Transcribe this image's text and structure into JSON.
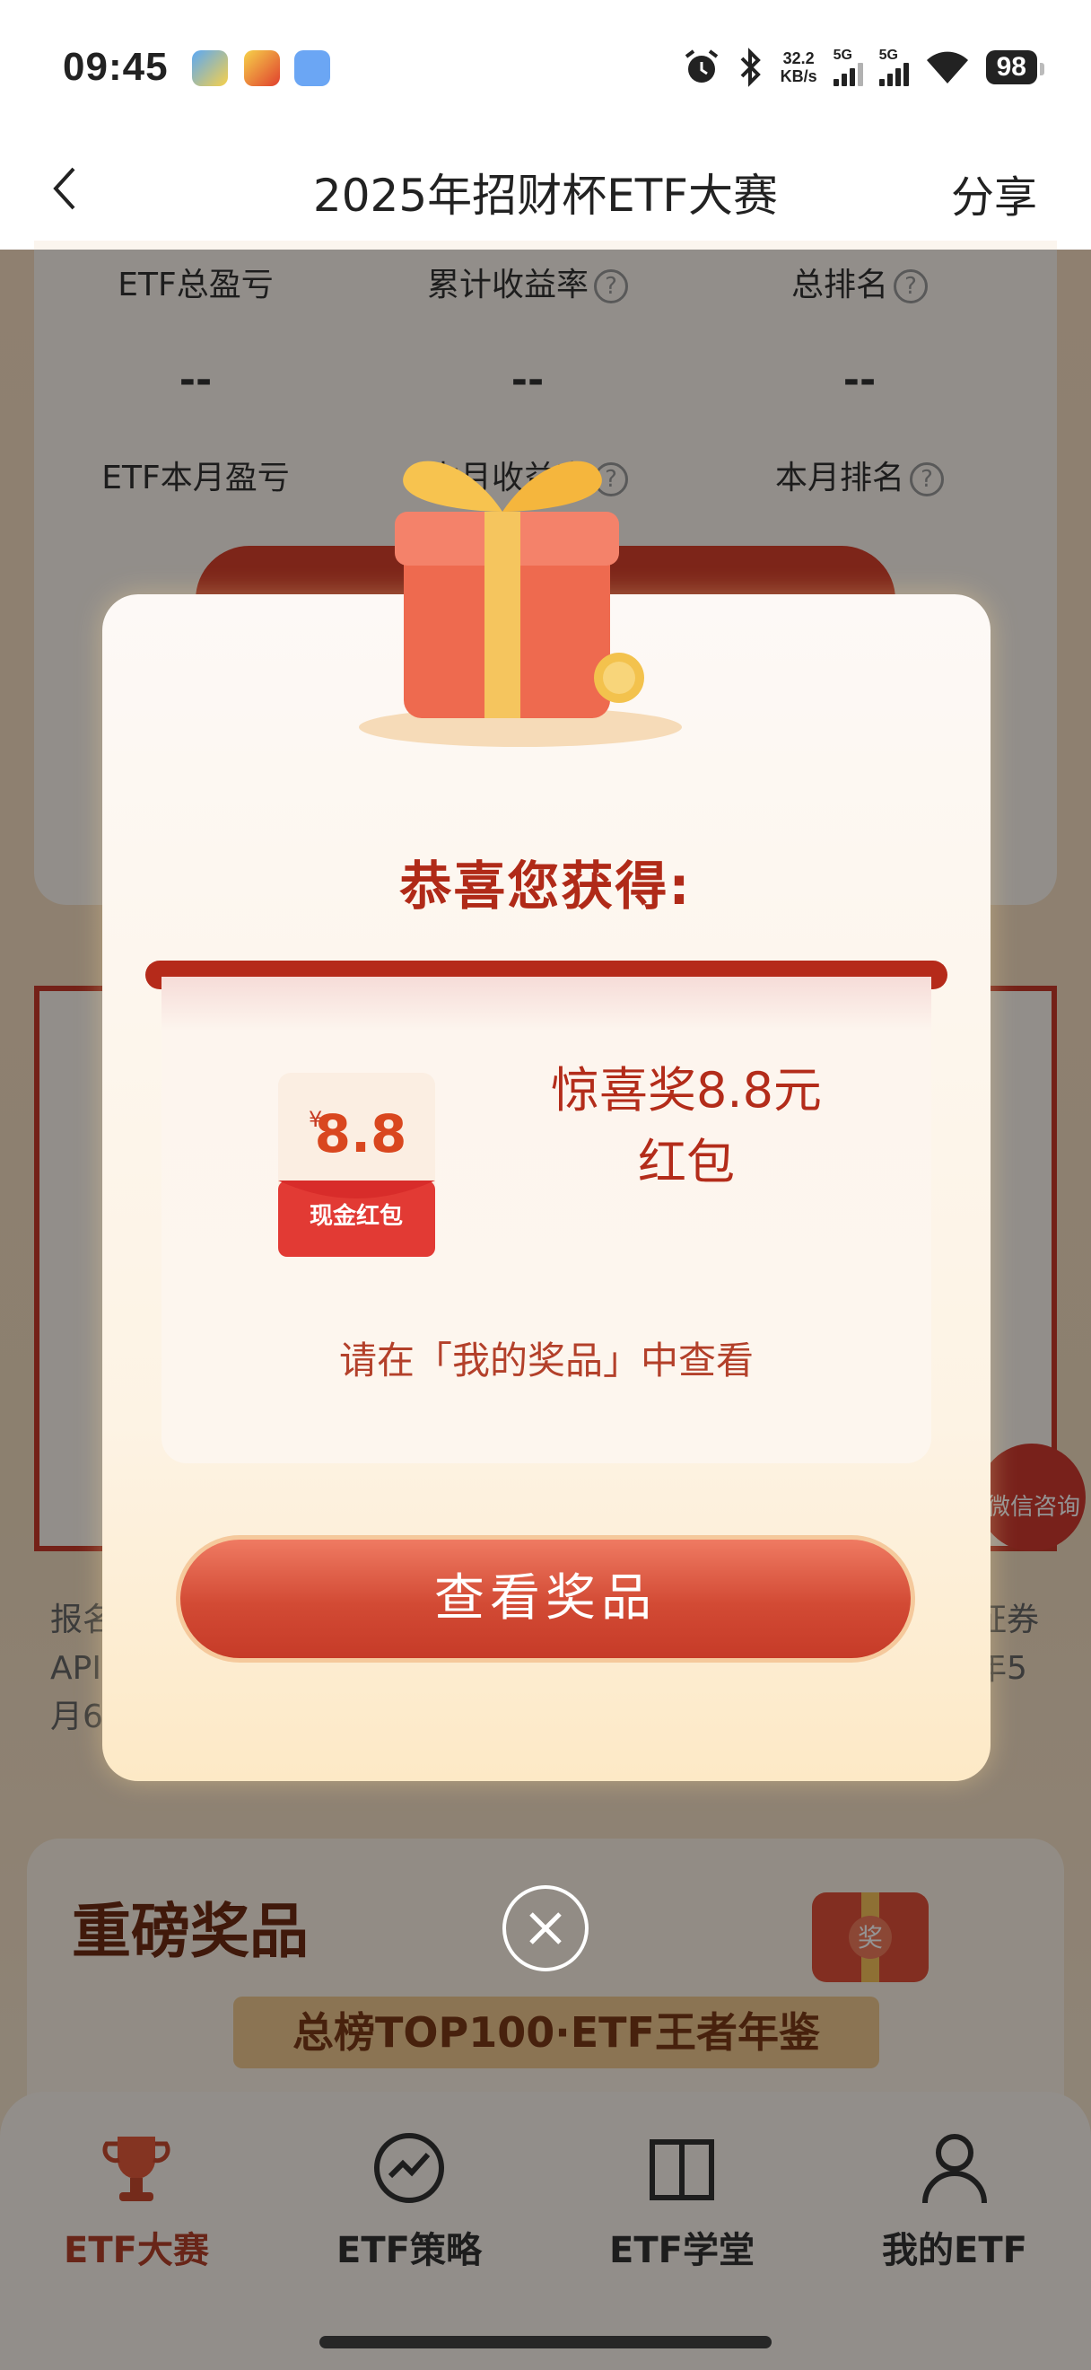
{
  "status_bar": {
    "time": "09:45",
    "speed_value": "32.2",
    "speed_unit": "KB/s",
    "network_1": "5G",
    "network_2": "5G",
    "battery": "98",
    "icons": [
      "alarm-icon",
      "bluetooth-icon",
      "wifi-icon"
    ]
  },
  "nav": {
    "title": "2025年招财杯ETF大赛",
    "share_label": "分享"
  },
  "stats": {
    "row1": [
      {
        "label": "ETF总盈亏",
        "value": "--"
      },
      {
        "label": "累计收益率",
        "value": "--"
      },
      {
        "label": "总排名",
        "value": "--"
      }
    ],
    "row2": [
      {
        "label": "ETF本月盈亏"
      },
      {
        "label": "本月收益率"
      },
      {
        "label": "本月排名"
      }
    ]
  },
  "background": {
    "consult_label": "微信咨询",
    "text_left": [
      "报名",
      "API",
      "月6"
    ],
    "text_right": [
      "证券",
      "年5"
    ],
    "prize_section_title": "重磅奖品",
    "prize_ribbon": "总榜TOP100·ETF王者年鉴",
    "prize_badge": "奖"
  },
  "modal": {
    "title": "恭喜您获得:",
    "packet_amount": "8.8",
    "packet_currency": "¥",
    "packet_label": "现金红包",
    "prize_line1": "惊喜奖8.8元",
    "prize_line2": "红包",
    "hint": "请在「我的奖品」中查看",
    "view_button": "查看奖品"
  },
  "tabs": [
    {
      "label": "ETF大赛",
      "icon": "trophy-icon",
      "active": true
    },
    {
      "label": "ETF策略",
      "icon": "strategy-chart-icon",
      "active": false
    },
    {
      "label": "ETF学堂",
      "icon": "book-icon",
      "active": false
    },
    {
      "label": "我的ETF",
      "icon": "user-icon",
      "active": false
    }
  ],
  "colors": {
    "accent_red": "#b02a18",
    "button_red": "#d24a34",
    "tab_active": "#b3402a"
  }
}
